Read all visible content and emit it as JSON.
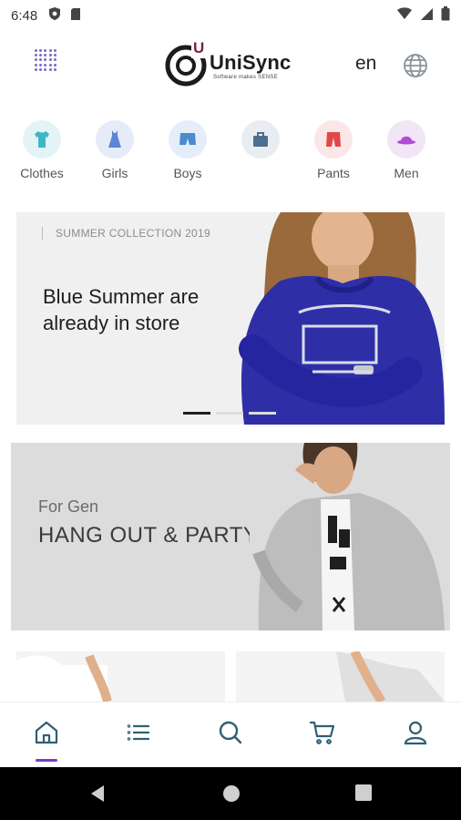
{
  "status_bar": {
    "time": "6:48"
  },
  "header": {
    "brand_letter": "U",
    "brand_name": "UniSync",
    "tagline": "Software makes SENSE",
    "language": "en"
  },
  "categories": [
    {
      "label": "Clothes",
      "icon": "shirt-icon",
      "bg": "#e3f4f6",
      "color": "#3fb6c4"
    },
    {
      "label": "Girls",
      "icon": "dress-icon",
      "bg": "#e6ecf7",
      "color": "#5a86d4"
    },
    {
      "label": "Boys",
      "icon": "shorts-icon",
      "bg": "#e5eef8",
      "color": "#4a8ad0"
    },
    {
      "label": "",
      "icon": "bag-icon",
      "bg": "#e9edf2",
      "color": "#4d6e90"
    },
    {
      "label": "Pants",
      "icon": "pants-icon",
      "bg": "#fbe7e7",
      "color": "#e04848"
    },
    {
      "label": "Men",
      "icon": "hat-icon",
      "bg": "#f1e6f6",
      "color": "#b44bd6"
    }
  ],
  "hero": {
    "kicker": "SUMMER COLLECTION 2019",
    "headline": "Blue Summer are already in store"
  },
  "promo": {
    "subtitle": "For Gen",
    "title": "HANG OUT & PARTY"
  },
  "colors": {
    "accent": "#7b3ec2",
    "nav_icon": "#2f5f73",
    "hero_bg": "#f0f0f0",
    "promo_bg": "#dcdcdc"
  },
  "bottom_nav": [
    {
      "icon": "home-icon",
      "active": true
    },
    {
      "icon": "list-icon",
      "active": false
    },
    {
      "icon": "search-icon",
      "active": false
    },
    {
      "icon": "cart-icon",
      "active": false
    },
    {
      "icon": "profile-icon",
      "active": false
    }
  ]
}
